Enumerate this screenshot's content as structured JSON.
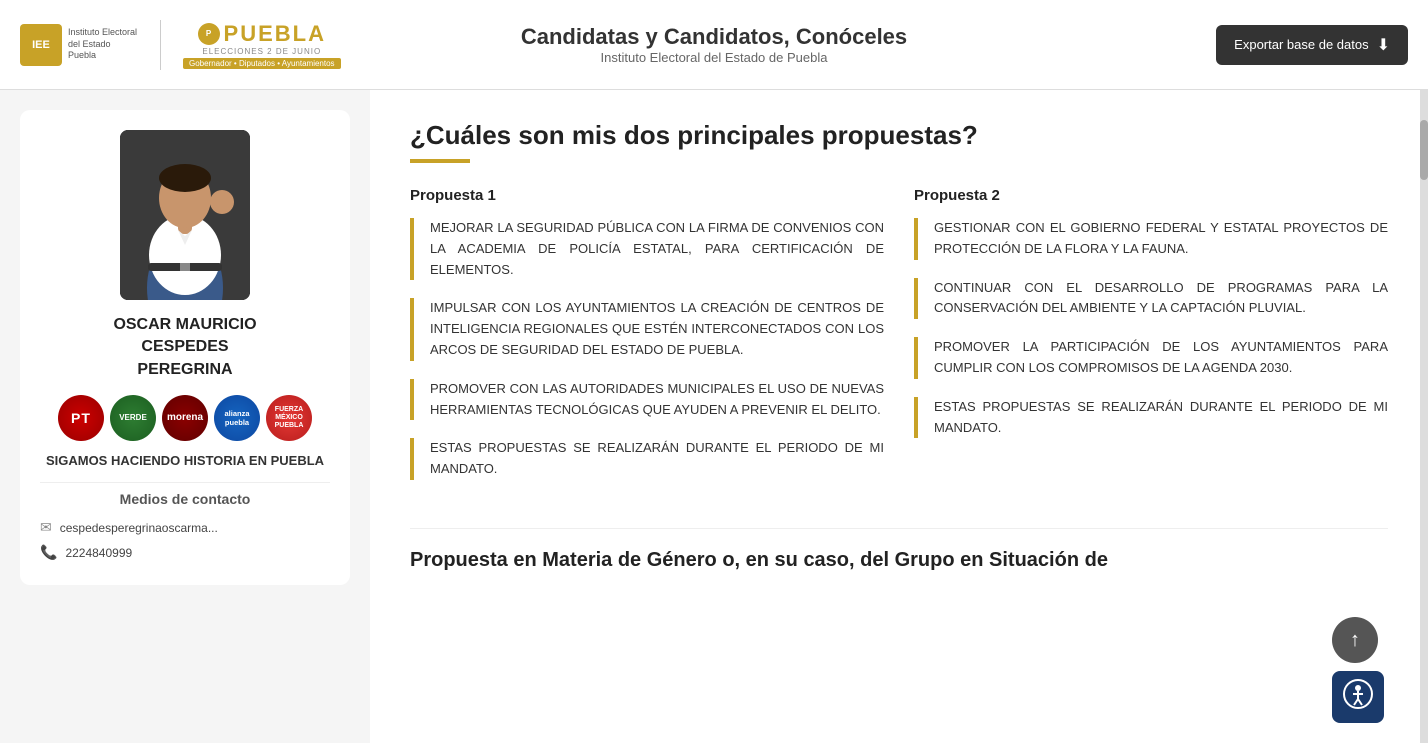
{
  "header": {
    "title": "Candidatas y Candidatos, Conóceles",
    "subtitle": "Instituto Electoral del Estado de Puebla",
    "export_btn": "Exportar base de datos",
    "logo_iee_text": "IEE",
    "logo_iee_full": "Instituto Electoral del Estado\nPuebla",
    "logo_puebla": "PUEBLA",
    "logo_puebla_sub": "ELECCIONES 2 DE JUNIO",
    "logo_puebla_badge": "Gobernador • Diputados • Ayuntamientos"
  },
  "candidate": {
    "name": "OSCAR MAURICIO\nCESPEDES\nPEREGRINA",
    "slogan": "SIGAMOS HACIENDO HISTORIA\nEN PUEBLA",
    "contact_title": "Medios de contacto",
    "email": "cespedesperegrinaoscarma...",
    "phone": "2224840999",
    "parties": [
      {
        "name": "PT",
        "class": "party-pt"
      },
      {
        "name": "VERDE",
        "class": "party-verde"
      },
      {
        "name": "morena",
        "class": "party-morena"
      },
      {
        "name": "alianza\npuebla",
        "class": "party-alianza"
      },
      {
        "name": "FUERZA\nMÉXICO\nPUEBLA",
        "class": "party-fuerza"
      }
    ]
  },
  "proposals_section": {
    "title": "¿Cuáles son mis dos principales propuestas?",
    "proposal1_label": "Propuesta 1",
    "proposal2_label": "Propuesta 2",
    "proposal1_items": [
      "MEJORAR LA SEGURIDAD PÚBLICA CON LA FIRMA DE CONVENIOS CON LA ACADEMIA DE POLICÍA ESTATAL, PARA CERTIFICACIÓN DE ELEMENTOS.",
      "IMPULSAR CON LOS AYUNTAMIENTOS LA CREACIÓN DE CENTROS DE INTELIGENCIA REGIONALES QUE ESTÉN INTERCONECTADOS CON LOS ARCOS DE SEGURIDAD DEL ESTADO DE PUEBLA.",
      "PROMOVER CON LAS AUTORIDADES MUNICIPALES EL USO DE NUEVAS HERRAMIENTAS TECNOLÓGICAS QUE AYUDEN A PREVENIR EL DELITO.",
      "ESTAS PROPUESTAS SE REALIZARÁN DURANTE EL PERIODO DE MI MANDATO."
    ],
    "proposal2_items": [
      "GESTIONAR CON EL GOBIERNO FEDERAL Y ESTATAL PROYECTOS DE PROTECCIÓN DE LA FLORA Y LA FAUNA.",
      "CONTINUAR CON EL DESARROLLO DE PROGRAMAS PARA LA CONSERVACIÓN DEL AMBIENTE Y LA CAPTACIÓN PLUVIAL.",
      "PROMOVER LA PARTICIPACIÓN DE LOS AYUNTAMIENTOS PARA CUMPLIR CON LOS COMPROMISOS DE LA AGENDA 2030.",
      "ESTAS PROPUESTAS SE REALIZARÁN DURANTE EL PERIODO DE MI MANDATO."
    ]
  },
  "next_section": {
    "title": "Propuesta en Materia de Género o, en su caso, del Grupo en Situación de"
  },
  "scroll_top_icon": "↑",
  "accessibility_icon": "♿"
}
